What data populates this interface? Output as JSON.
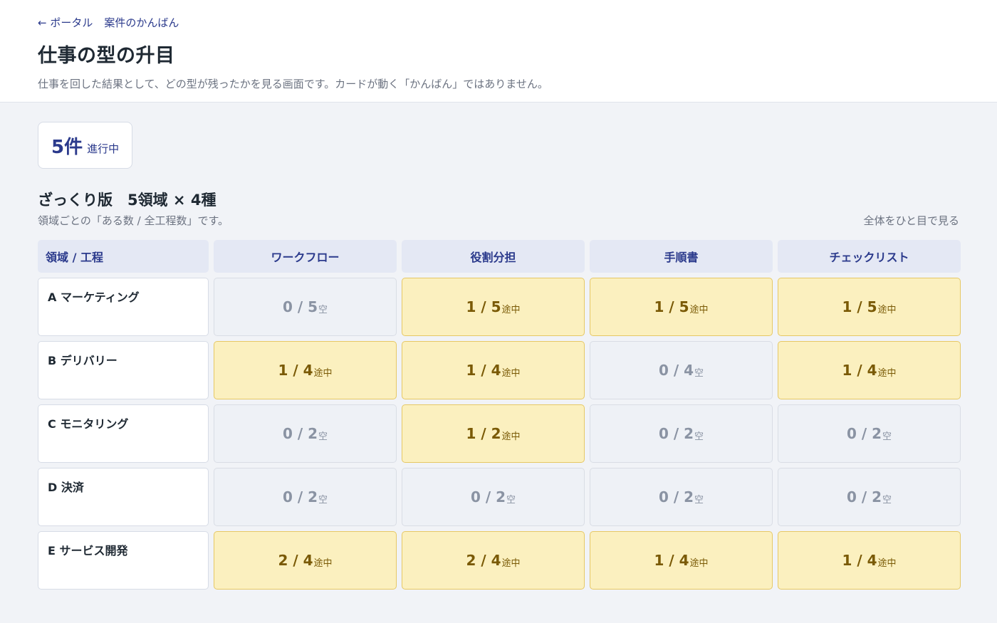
{
  "breadcrumb": {
    "back": "← ポータル",
    "current": "案件のかんばん"
  },
  "page": {
    "title": "仕事の型の升目",
    "description": "仕事を回した結果として、どの型が残ったかを見る画面です。カードが動く「かんばん」ではありません。"
  },
  "summary": {
    "count": "5件",
    "label": "進行中"
  },
  "section": {
    "title": "ざっくり版　5領域 × 4種",
    "subtitle": "領域ごとの「ある数 / 全工程数」です。",
    "overview_link": "全体をひと目で見る"
  },
  "table": {
    "corner": "領域 / 工程",
    "columns": [
      "ワークフロー",
      "役割分担",
      "手順書",
      "チェックリスト"
    ],
    "rows": [
      {
        "label": "A マーケティング",
        "cells": [
          {
            "ratio": "0 / 5",
            "status": "空"
          },
          {
            "ratio": "1 / 5",
            "status": "途中"
          },
          {
            "ratio": "1 / 5",
            "status": "途中"
          },
          {
            "ratio": "1 / 5",
            "status": "途中"
          }
        ]
      },
      {
        "label": "B デリバリー",
        "cells": [
          {
            "ratio": "1 / 4",
            "status": "途中"
          },
          {
            "ratio": "1 / 4",
            "status": "途中"
          },
          {
            "ratio": "0 / 4",
            "status": "空"
          },
          {
            "ratio": "1 / 4",
            "status": "途中"
          }
        ]
      },
      {
        "label": "C モニタリング",
        "cells": [
          {
            "ratio": "0 / 2",
            "status": "空"
          },
          {
            "ratio": "1 / 2",
            "status": "途中"
          },
          {
            "ratio": "0 / 2",
            "status": "空"
          },
          {
            "ratio": "0 / 2",
            "status": "空"
          }
        ]
      },
      {
        "label": "D 決済",
        "cells": [
          {
            "ratio": "0 / 2",
            "status": "空"
          },
          {
            "ratio": "0 / 2",
            "status": "空"
          },
          {
            "ratio": "0 / 2",
            "status": "空"
          },
          {
            "ratio": "0 / 2",
            "status": "空"
          }
        ]
      },
      {
        "label": "E サービス開発",
        "cells": [
          {
            "ratio": "2 / 4",
            "status": "途中"
          },
          {
            "ratio": "2 / 4",
            "status": "途中"
          },
          {
            "ratio": "1 / 4",
            "status": "途中"
          },
          {
            "ratio": "1 / 4",
            "status": "途中"
          }
        ]
      }
    ]
  },
  "colors": {
    "accent": "#2b3a8c",
    "active_bg": "#fbf0bf",
    "active_border": "#e6c865",
    "empty_bg": "#eef1f6"
  }
}
